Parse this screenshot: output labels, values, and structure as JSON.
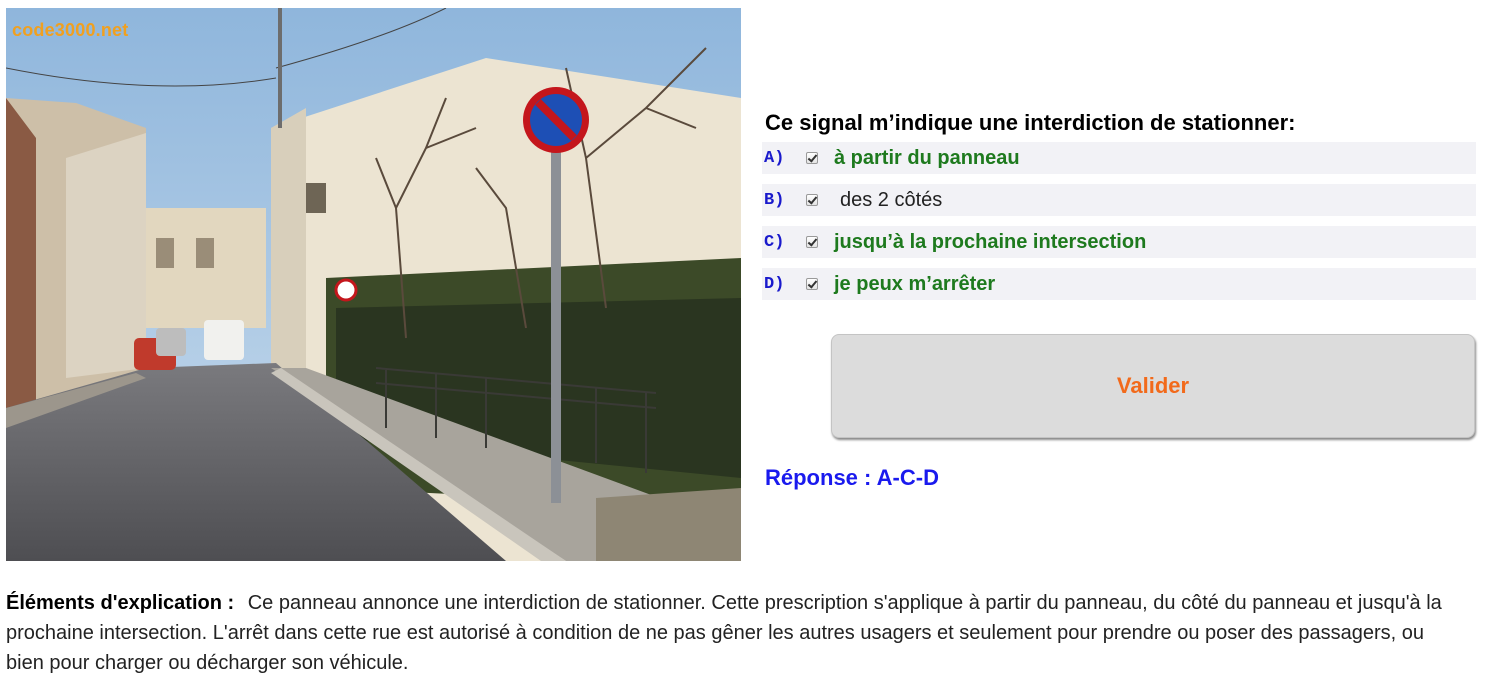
{
  "photo": {
    "watermark": "code3000.net"
  },
  "question": {
    "text": "Ce signal m’indique une interdiction de stationner:"
  },
  "answers": [
    {
      "letter": "A)",
      "text": "à partir du panneau",
      "checked": true,
      "correct": true
    },
    {
      "letter": "B)",
      "text": "des 2 côtés",
      "checked": true,
      "correct": false
    },
    {
      "letter": "C)",
      "text": "jusqu’à la prochaine intersection",
      "checked": true,
      "correct": true
    },
    {
      "letter": "D)",
      "text": "je peux m’arrêter",
      "checked": true,
      "correct": true
    }
  ],
  "validate": {
    "label": "Valider"
  },
  "response": {
    "text": "Réponse : A-C-D"
  },
  "explanation": {
    "title": "Éléments d'explication :",
    "body": "Ce panneau annonce une interdiction de stationner. Cette prescription s'applique à partir du panneau, du côté du panneau et jusqu'à la prochaine intersection. L'arrêt dans cette rue est autorisé à condition de ne pas gêner les autres usagers et seulement pour prendre ou poser des passagers, ou bien pour charger ou décharger son véhicule."
  },
  "colors": {
    "correct_answer": "#1e7a1e",
    "letter": "#1a1acc",
    "validate_label": "#f26a1b",
    "response": "#1a1aee"
  }
}
